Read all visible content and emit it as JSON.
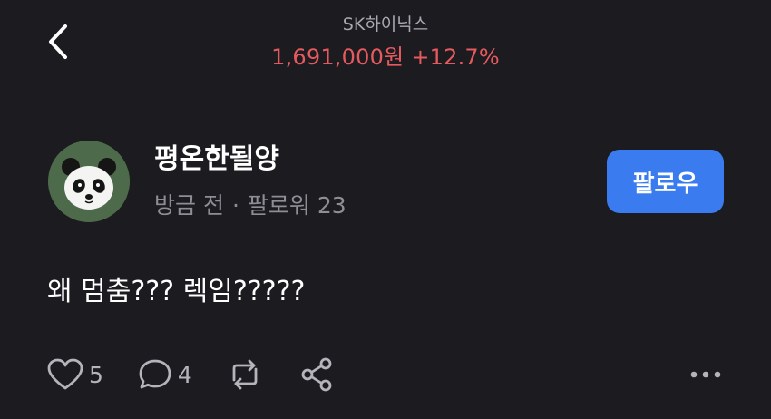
{
  "header": {
    "stock_name": "SK하이닉스",
    "price": "1,691,000원",
    "change": "+12.7%"
  },
  "post": {
    "author": "평온한될양",
    "time": "방금 전",
    "separator": "·",
    "followers": "팔로워 23",
    "follow_label": "팔로우",
    "content": "왜 멈춤??? 렉임?????"
  },
  "actions": {
    "likes": "5",
    "comments": "4"
  },
  "colors": {
    "background": "#1b1b20",
    "price_up": "#e55a5f",
    "follow_button": "#3a7cf0",
    "avatar_bg": "#4d6b4a"
  },
  "icons": [
    "chevron-left-icon",
    "panda-avatar",
    "heart-icon",
    "comment-icon",
    "repost-icon",
    "share-icon",
    "more-icon"
  ]
}
